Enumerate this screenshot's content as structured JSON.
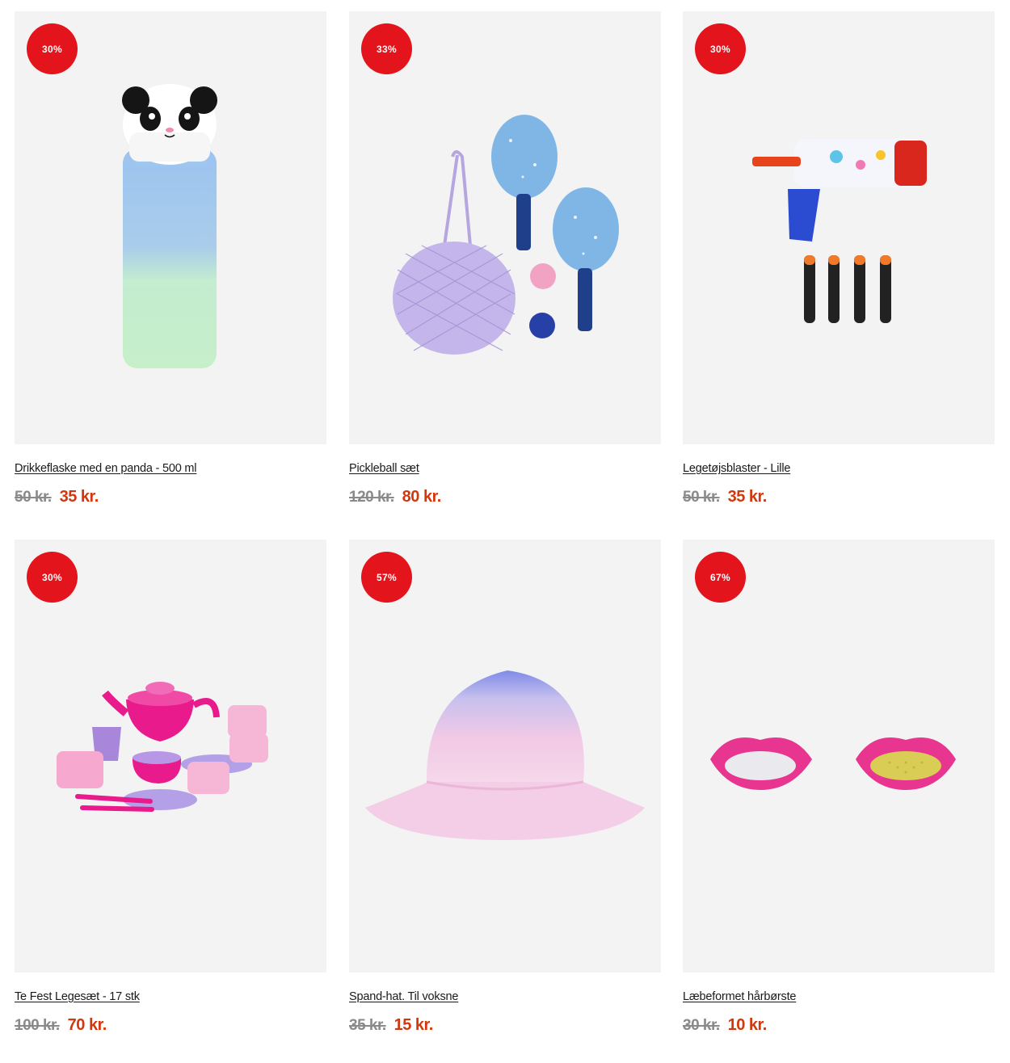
{
  "colors": {
    "badge": "#e3141b",
    "sale_price": "#d2380d",
    "old_price": "#8a8a8a",
    "card_background": "#f3f3f3"
  },
  "products": [
    {
      "discount": "30%",
      "title": "Drikkeflaske med en panda - 500 ml",
      "old_price": "50 kr.",
      "new_price": "35 kr.",
      "image_icon": "panda-water-bottle-image"
    },
    {
      "discount": "33%",
      "title": "Pickleball sæt",
      "old_price": "120 kr.",
      "new_price": "80 kr.",
      "image_icon": "pickleball-set-image"
    },
    {
      "discount": "30%",
      "title": "Legetøjsblaster - Lille",
      "old_price": "50 kr.",
      "new_price": "35 kr.",
      "image_icon": "toy-blaster-image"
    },
    {
      "discount": "30%",
      "title": "Te Fest Legesæt - 17 stk",
      "old_price": "100 kr.",
      "new_price": "70 kr.",
      "image_icon": "tea-party-set-image"
    },
    {
      "discount": "57%",
      "title": "Spand-hat. Til voksne",
      "old_price": "35 kr.",
      "new_price": "15 kr.",
      "image_icon": "bucket-hat-image"
    },
    {
      "discount": "67%",
      "title": "Læbeformet hårbørste",
      "old_price": "30 kr.",
      "new_price": "10 kr.",
      "image_icon": "lip-hairbrush-image"
    }
  ]
}
